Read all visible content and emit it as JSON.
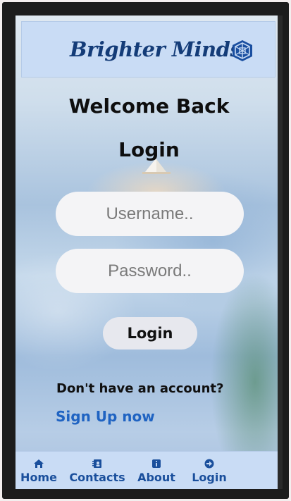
{
  "header": {
    "brand": "Brighter Minds",
    "logo_icon": "cube-logo-icon"
  },
  "main": {
    "welcome": "Welcome Back",
    "title": "Login",
    "username_placeholder": "Username..",
    "password_placeholder": "Password..",
    "login_button": "Login",
    "no_account_text": "Don't have an account?",
    "signup_link": "Sign Up now"
  },
  "bottom_nav": {
    "items": [
      {
        "label": "Home",
        "icon": "home-icon"
      },
      {
        "label": "Contacts",
        "icon": "address-book-icon"
      },
      {
        "label": "About",
        "icon": "info-icon"
      },
      {
        "label": "Login",
        "icon": "login-arrow-icon"
      }
    ]
  },
  "colors": {
    "header_bg": "#c9dcf5",
    "brand_text": "#143c78",
    "link": "#1f63c2",
    "nav_text": "#1a4f9c"
  }
}
